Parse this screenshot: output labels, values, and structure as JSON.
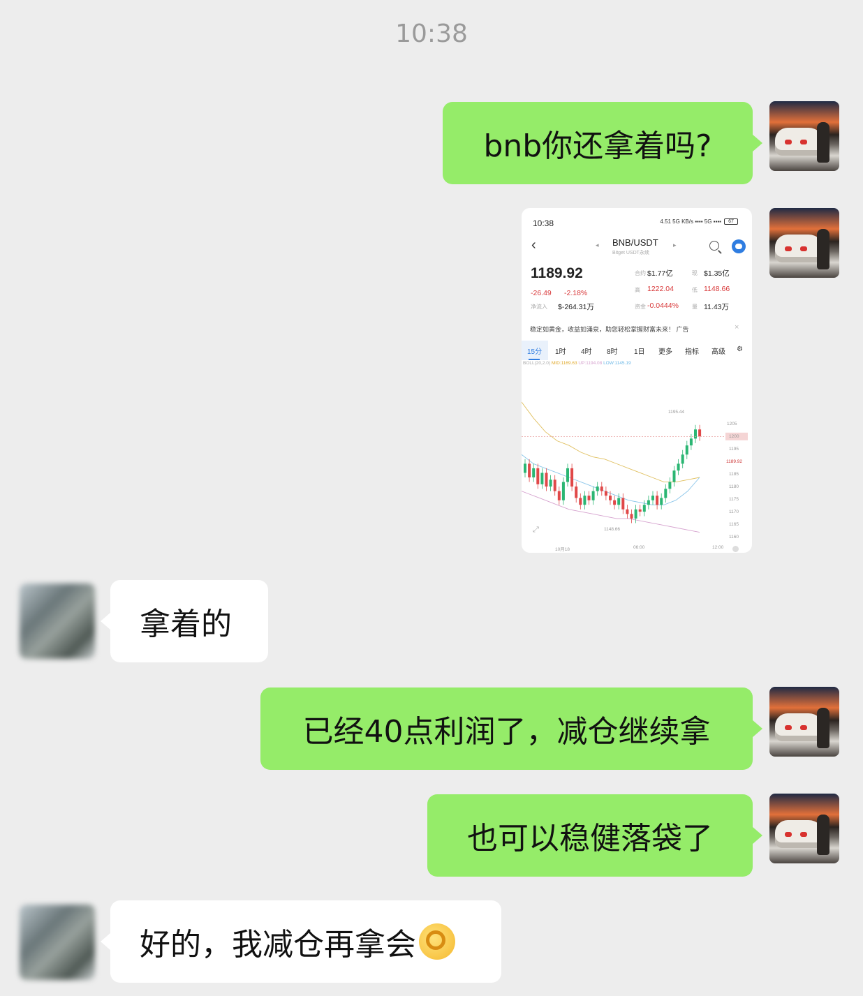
{
  "timestamp": "10:38",
  "messages": [
    {
      "text": "bnb你还拿着吗?"
    },
    {
      "text": "拿着的"
    },
    {
      "text": "已经40点利润了，减仓继续拿"
    },
    {
      "text": "也可以稳健落袋了"
    },
    {
      "text": "好的，我减仓再拿会",
      "emoji": "ok-hand-emoji"
    }
  ],
  "screenshot": {
    "time": "10:38",
    "status": "4.51 5G KB/s ▪▪▪▪ 5G ▪▪▪▪",
    "battery": "67",
    "pair": "BNB/USDT",
    "pair_sub": "Bitget USDT永续",
    "price": "1189.92",
    "change": "-26.49",
    "change_pct": "-2.18%",
    "net_inflow_label": "净流入",
    "net_inflow": "$-264.31万",
    "stats": [
      {
        "label": "合约",
        "value": "$1.77亿",
        "red": false
      },
      {
        "label": "现",
        "value": "$1.35亿",
        "red": false
      },
      {
        "label": "高",
        "value": "1222.04",
        "red": true
      },
      {
        "label": "低",
        "value": "1148.66",
        "red": true
      },
      {
        "label": "资金",
        "value": "-0.0444%",
        "red": true
      },
      {
        "label": "量",
        "value": "11.43万",
        "red": false
      }
    ],
    "ad": "稳定如黄金，收益如涌泉，助您轻松掌握财富未来！ 广告",
    "timeframes": [
      "15分",
      "1时",
      "4时",
      "8时",
      "1日",
      "更多",
      "指标",
      "高级"
    ],
    "boll": {
      "prefix": "BOLL(20,2.0)",
      "mid": "MID:1169.63",
      "up": "UP:1194.08",
      "low": "LOW:1145.19"
    },
    "chart_data": {
      "type": "candlestick",
      "ylim": [
        1150,
        1205
      ],
      "y_ticks": [
        "1205",
        "1200",
        "1195",
        "1189.92",
        "1185",
        "1180",
        "1175",
        "1170",
        "1165",
        "1160",
        "1155",
        "1150"
      ],
      "x_ticks": [
        "10月18",
        "06:00",
        "12:00"
      ],
      "annotations": [
        "1195.44",
        "1148.66"
      ],
      "current_price": 1189.92
    }
  }
}
